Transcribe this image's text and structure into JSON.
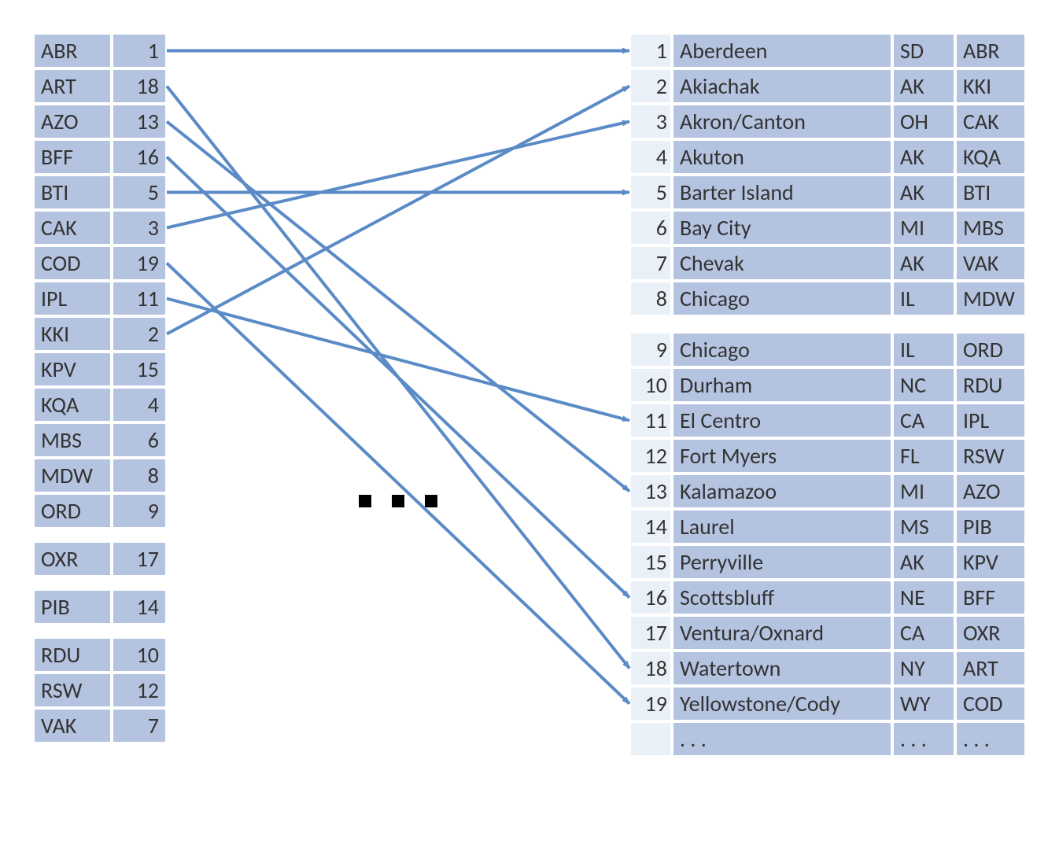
{
  "colors": {
    "cell": "#b4c4e0",
    "index": "#eaf0f8",
    "arrow": "#5b8bc6"
  },
  "left_table": [
    {
      "code": "ABR",
      "n": 1
    },
    {
      "code": "ART",
      "n": 18
    },
    {
      "code": "AZO",
      "n": 13
    },
    {
      "code": "BFF",
      "n": 16
    },
    {
      "code": "BTI",
      "n": 5
    },
    {
      "code": "CAK",
      "n": 3
    },
    {
      "code": "COD",
      "n": 19
    },
    {
      "code": "IPL",
      "n": 11
    },
    {
      "code": "KKI",
      "n": 2
    },
    {
      "code": "KPV",
      "n": 15
    },
    {
      "code": "KQA",
      "n": 4
    },
    {
      "code": "MBS",
      "n": 6
    },
    {
      "code": "MDW",
      "n": 8
    },
    {
      "code": "ORD",
      "n": 9
    },
    {
      "code": "OXR",
      "n": 17
    },
    {
      "code": "PIB",
      "n": 14
    },
    {
      "code": "RDU",
      "n": 10
    },
    {
      "code": "RSW",
      "n": 12
    },
    {
      "code": "VAK",
      "n": 7
    }
  ],
  "left_spacers": [
    13,
    14,
    15
  ],
  "right_table": [
    {
      "i": 1,
      "city": "Aberdeen",
      "state": "SD",
      "code": "ABR"
    },
    {
      "i": 2,
      "city": "Akiachak",
      "state": "AK",
      "code": "KKI"
    },
    {
      "i": 3,
      "city": "Akron/Canton",
      "state": "OH",
      "code": "CAK"
    },
    {
      "i": 4,
      "city": "Akuton",
      "state": "AK",
      "code": "KQA"
    },
    {
      "i": 5,
      "city": "Barter Island",
      "state": "AK",
      "code": "BTI"
    },
    {
      "i": 6,
      "city": "Bay City",
      "state": "MI",
      "code": "MBS"
    },
    {
      "i": 7,
      "city": "Chevak",
      "state": "AK",
      "code": "VAK"
    },
    {
      "i": 8,
      "city": "Chicago",
      "state": "IL",
      "code": "MDW"
    },
    {
      "i": 9,
      "city": "Chicago",
      "state": "IL",
      "code": "ORD"
    },
    {
      "i": 10,
      "city": "Durham",
      "state": "NC",
      "code": "RDU"
    },
    {
      "i": 11,
      "city": "El Centro",
      "state": "CA",
      "code": "IPL"
    },
    {
      "i": 12,
      "city": "Fort Myers",
      "state": "FL",
      "code": "RSW"
    },
    {
      "i": 13,
      "city": "Kalamazoo",
      "state": "MI",
      "code": "AZO"
    },
    {
      "i": 14,
      "city": "Laurel",
      "state": "MS",
      "code": "PIB"
    },
    {
      "i": 15,
      "city": "Perryville",
      "state": "AK",
      "code": "KPV"
    },
    {
      "i": 16,
      "city": "Scottsbluff",
      "state": "NE",
      "code": "BFF"
    },
    {
      "i": 17,
      "city": "Ventura/Oxnard",
      "state": "CA",
      "code": "OXR"
    },
    {
      "i": 18,
      "city": "Watertown",
      "state": "NY",
      "code": "ART"
    },
    {
      "i": 19,
      "city": "Yellowstone/Cody",
      "state": "WY",
      "code": "COD"
    }
  ],
  "right_spacers": [
    7
  ],
  "right_ellipsis_row": {
    "city": ". . .",
    "state": ". . .",
    "code": ". . ."
  },
  "arrows": [
    {
      "from": "ABR",
      "to": 1
    },
    {
      "from": "ART",
      "to": 18
    },
    {
      "from": "AZO",
      "to": 13
    },
    {
      "from": "BFF",
      "to": 16
    },
    {
      "from": "BTI",
      "to": 5
    },
    {
      "from": "CAK",
      "to": 3
    },
    {
      "from": "COD",
      "to": 19
    },
    {
      "from": "IPL",
      "to": 11
    },
    {
      "from": "KKI",
      "to": 2
    }
  ]
}
